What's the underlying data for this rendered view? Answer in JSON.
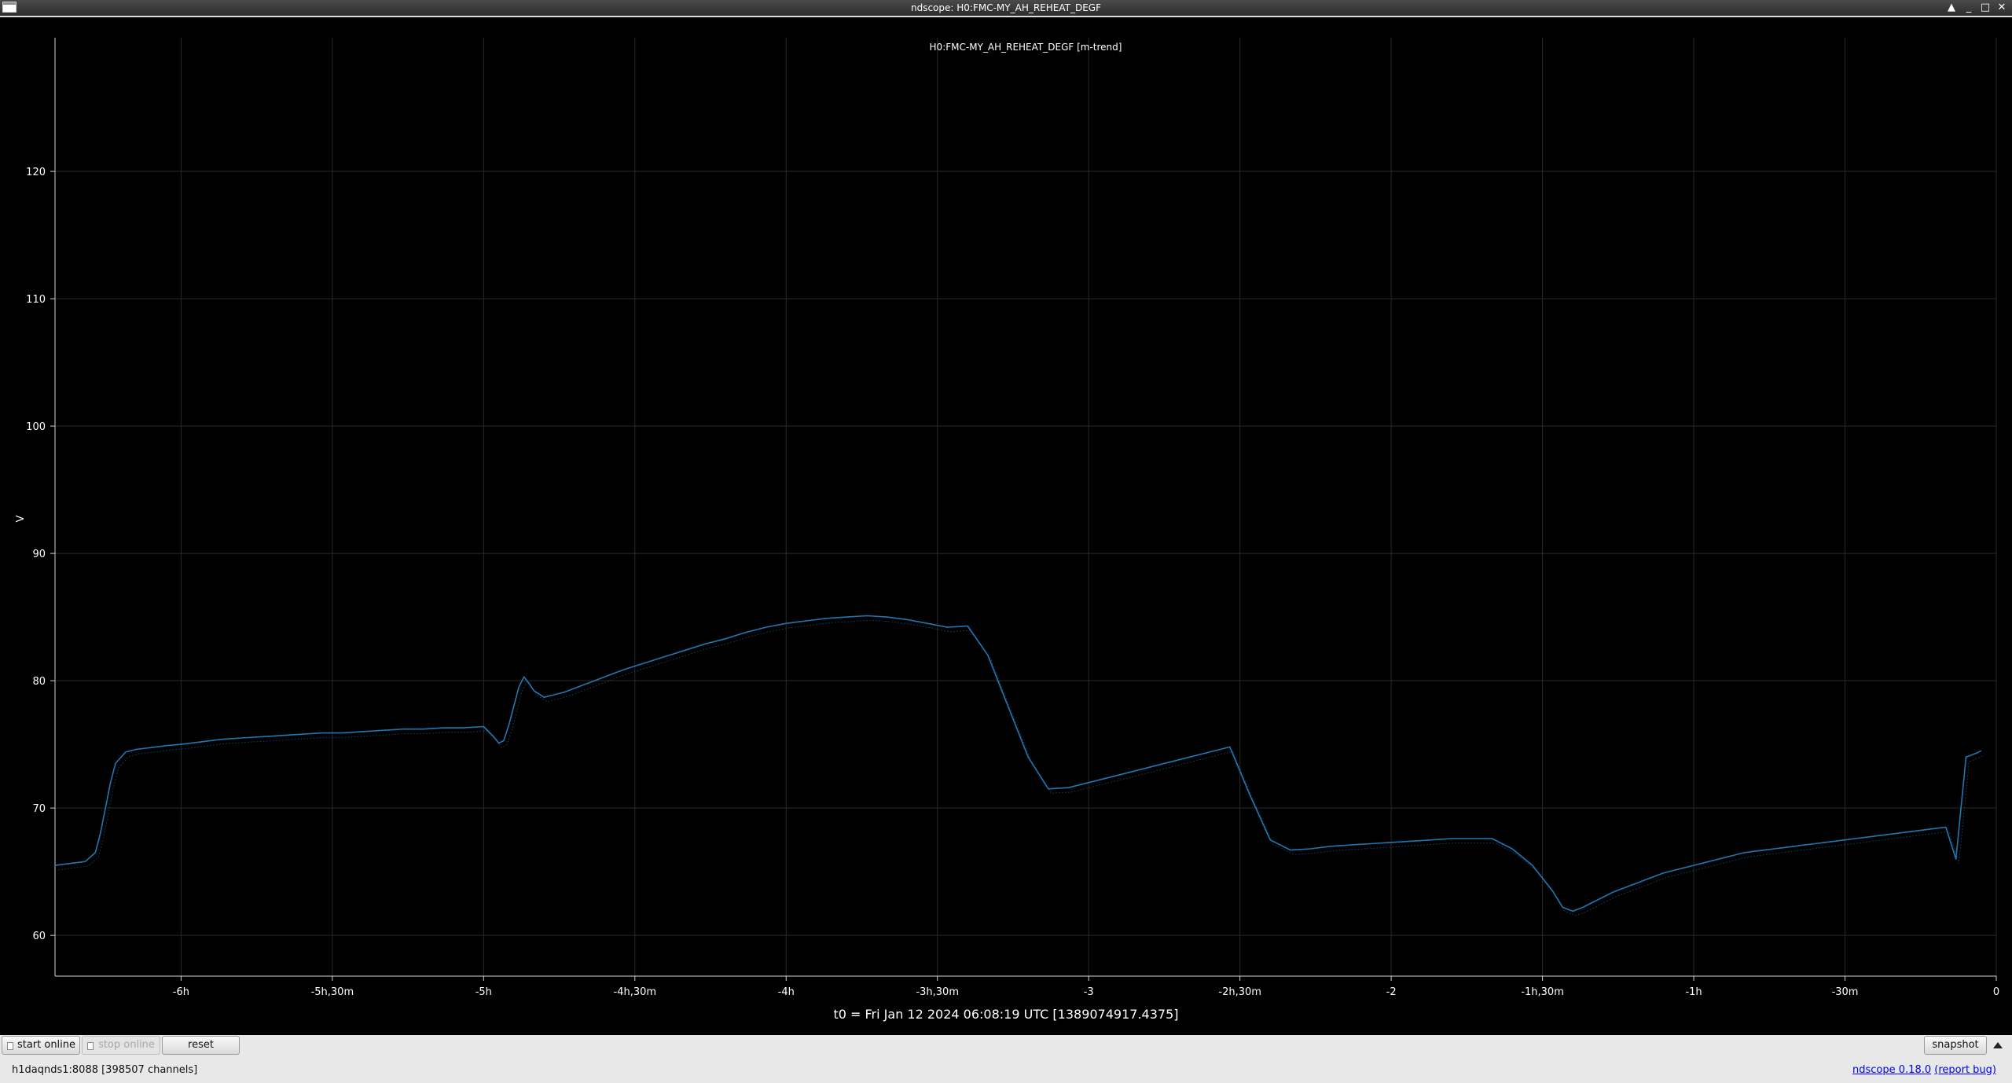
{
  "window": {
    "title": "ndscope: H0:FMC-MY_AH_REHEAT_DEGF",
    "controls": [
      "▲",
      "_",
      "□",
      "✕"
    ]
  },
  "plot": {
    "colors": {
      "background": "#000000",
      "axis": "#cfcfcf",
      "grid": "#2a2a2a",
      "trace": "#1f77b4",
      "text": "#ffffff"
    }
  },
  "chart_data": {
    "type": "line",
    "title": "H0:FMC-MY_AH_REHEAT_DEGF [m-trend]",
    "ylabel": "V",
    "xlabel": "",
    "xlim_minutes": [
      -385,
      0
    ],
    "ylim": [
      56.8,
      130.5
    ],
    "grid": true,
    "x_tick_values": [
      -360,
      -330,
      -300,
      -270,
      -240,
      -210,
      -180,
      -150,
      -120,
      -90,
      -60,
      -30,
      0
    ],
    "x_tick_labels": [
      "-6h",
      "-5h,30m",
      "-5h",
      "-4h,30m",
      "-4h",
      "-3h,30m",
      "-3",
      "-2h,30m",
      "-2",
      "-1h,30m",
      "-1h",
      "-30m",
      "0"
    ],
    "y_ticks": [
      60,
      70,
      80,
      90,
      100,
      110,
      120
    ],
    "series": [
      {
        "x_minutes": [
          -385,
          -383,
          -381,
          -379,
          -377,
          -376,
          -375,
          -374,
          -373,
          -371,
          -369,
          -367,
          -365,
          -363,
          -360,
          -356,
          -352,
          -348,
          -344,
          -340,
          -336,
          -332,
          -328,
          -324,
          -320,
          -316,
          -312,
          -308,
          -304,
          -300,
          -298,
          -297,
          -296,
          -295,
          -294,
          -293,
          -292,
          -291,
          -290,
          -288,
          -286,
          -284,
          -282,
          -280,
          -278,
          -276,
          -274,
          -272,
          -268,
          -264,
          -260,
          -256,
          -252,
          -248,
          -244,
          -240,
          -236,
          -232,
          -228,
          -224,
          -220,
          -216,
          -212,
          -208,
          -204,
          -200,
          -196,
          -192,
          -188,
          -184,
          -180,
          -176,
          -172,
          -168,
          -164,
          -160,
          -156,
          -152,
          -148,
          -144,
          -140,
          -136,
          -132,
          -128,
          -124,
          -120,
          -116,
          -112,
          -108,
          -104,
          -100,
          -96,
          -92,
          -88,
          -86,
          -84,
          -82,
          -80,
          -78,
          -76,
          -74,
          -72,
          -70,
          -68,
          -66,
          -64,
          -62,
          -60,
          -58,
          -56,
          -54,
          -52,
          -50,
          -48,
          -46,
          -44,
          -42,
          -40,
          -38,
          -36,
          -34,
          -32,
          -30,
          -28,
          -26,
          -24,
          -22,
          -20,
          -18,
          -16,
          -14,
          -12,
          -10,
          -8,
          -6,
          -4,
          -3,
          -2,
          -1
        ],
        "y": [
          65.5,
          65.6,
          65.7,
          65.8,
          66.5,
          68.0,
          70.0,
          72.0,
          73.5,
          74.4,
          74.6,
          74.7,
          74.8,
          74.9,
          75.0,
          75.2,
          75.4,
          75.5,
          75.6,
          75.7,
          75.8,
          75.9,
          75.9,
          76.0,
          76.1,
          76.2,
          76.2,
          76.3,
          76.3,
          76.4,
          75.6,
          75.1,
          75.3,
          76.5,
          78.0,
          79.5,
          80.3,
          79.8,
          79.2,
          78.7,
          78.9,
          79.1,
          79.4,
          79.7,
          80.0,
          80.3,
          80.6,
          80.9,
          81.4,
          81.9,
          82.4,
          82.9,
          83.3,
          83.8,
          84.2,
          84.5,
          84.7,
          84.9,
          85.0,
          85.1,
          85.0,
          84.8,
          84.5,
          84.2,
          84.3,
          82.0,
          78.0,
          74.0,
          71.5,
          71.6,
          72.0,
          72.4,
          72.8,
          73.2,
          73.6,
          74.0,
          74.4,
          74.8,
          71.0,
          67.5,
          66.7,
          66.8,
          67.0,
          67.1,
          67.2,
          67.3,
          67.4,
          67.5,
          67.6,
          67.6,
          67.6,
          66.8,
          65.5,
          63.5,
          62.2,
          61.9,
          62.2,
          62.6,
          63.0,
          63.4,
          63.7,
          64.0,
          64.3,
          64.6,
          64.9,
          65.1,
          65.3,
          65.5,
          65.7,
          65.9,
          66.1,
          66.3,
          66.5,
          66.6,
          66.7,
          66.8,
          66.9,
          67.0,
          67.1,
          67.2,
          67.3,
          67.4,
          67.5,
          67.6,
          67.7,
          67.8,
          67.9,
          68.0,
          68.1,
          68.2,
          68.3,
          68.4,
          68.5,
          66.0,
          74.0,
          74.3,
          74.5
        ],
        "_note": ""
      }
    ]
  },
  "t0": "t0 = Fri Jan 12 2024 06:08:19 UTC [1389074917.4375]",
  "toolbar": {
    "start_online": "start online",
    "stop_online": "stop online",
    "reset": "reset",
    "snapshot": "snapshot"
  },
  "statusbar": {
    "server": "h1daqnds1:8088  [398507 channels]",
    "version": "ndscope 0.18.0",
    "report_bug": "(report bug)"
  }
}
